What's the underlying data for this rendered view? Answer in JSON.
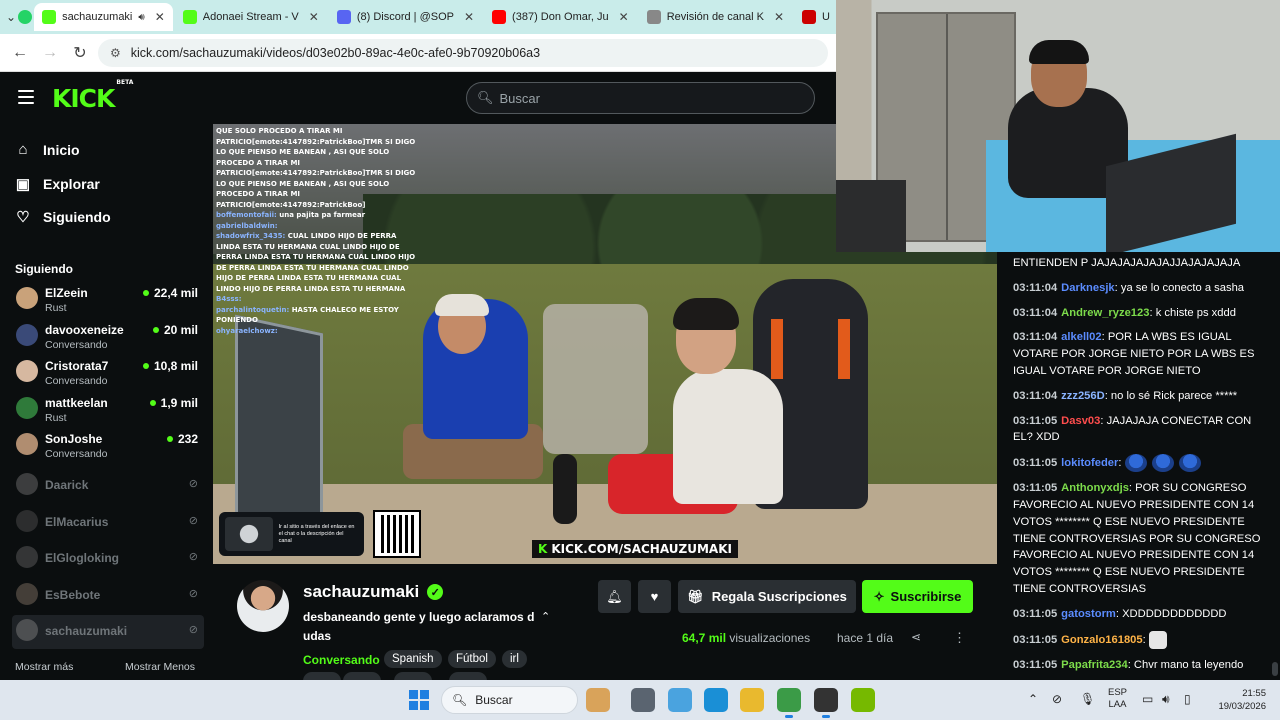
{
  "browser": {
    "tabs": [
      {
        "title": "sachauzumaki",
        "favicon_color": "#53fc18",
        "active": true,
        "audio": true
      },
      {
        "title": "Adonaei Stream - V",
        "favicon_color": "#53fc18",
        "active": false
      },
      {
        "title": "(8) Discord | @SOP",
        "favicon_color": "#5865f2",
        "active": false
      },
      {
        "title": "(387) Don Omar, Ju",
        "favicon_color": "#ff0000",
        "active": false
      },
      {
        "title": "Revisión de canal K",
        "favicon_color": "#888888",
        "active": false
      },
      {
        "title": "U",
        "favicon_color": "#cc0000",
        "active": false
      }
    ],
    "url": "kick.com/sachauzumaki/videos/d03e02b0-89ac-4e0c-afe0-9b70920b06a3"
  },
  "header": {
    "logo": "KICK",
    "logo_badge": "BETA",
    "search_placeholder": "Buscar"
  },
  "sidebar": {
    "nav": [
      {
        "label": "Inicio",
        "icon": "home-icon"
      },
      {
        "label": "Explorar",
        "icon": "compass-icon"
      },
      {
        "label": "Siguiendo",
        "icon": "heart-icon"
      }
    ],
    "following_title": "Siguiendo",
    "live_channels": [
      {
        "name": "ElZeein",
        "category": "Rust",
        "viewers": "22,4 mil",
        "avatar_color": "#c9a27a"
      },
      {
        "name": "davooxeneize",
        "category": "Conversando",
        "viewers": "20 mil",
        "avatar_color": "#3a4a78"
      },
      {
        "name": "Cristorata7",
        "category": "Conversando",
        "viewers": "10,8 mil",
        "avatar_color": "#d6b8a0"
      },
      {
        "name": "mattkeelan",
        "category": "Rust",
        "viewers": "1,9 mil",
        "avatar_color": "#2f7a3a"
      },
      {
        "name": "SonJoshe",
        "category": "Conversando",
        "viewers": "232",
        "avatar_color": "#b08d70"
      }
    ],
    "offline_channels": [
      {
        "name": "Daarick",
        "avatar_color": "#777777"
      },
      {
        "name": "ElMacarius",
        "avatar_color": "#555555"
      },
      {
        "name": "ElGlogloking",
        "avatar_color": "#666666"
      },
      {
        "name": "EsBebote",
        "avatar_color": "#8a7a6a"
      },
      {
        "name": "sachauzumaki",
        "avatar_color": "#888888"
      }
    ],
    "show_more": "Mostrar más",
    "show_less": "Mostrar Menos"
  },
  "video_overlay": {
    "chat_lines": [
      {
        "user": "",
        "text": "QUE SOLO PROCEDO A TIRAR MI PATRICIO[emote:4147892:PatrickBoo]TMR SI DIGO LO QUE PIENSO ME BANEAN , ASI QUE SOLO PROCEDO A TIRAR MI PATRICIO[emote:4147892:PatrickBoo]TMR SI DIGO LO QUE PIENSO ME BANEAN , ASI QUE SOLO PROCEDO A TIRAR MI PATRICIO[emote:4147892:PatrickBoo]"
      },
      {
        "user": "boffemontofaii:",
        "text": "una pajita pa farmear"
      },
      {
        "user": "gabrielbaldwin:",
        "text": ""
      },
      {
        "user": "shadowfrix_3435:",
        "text": "CUAL LINDO HIJO DE PERRA LINDA ESTA TU HERMANA CUAL LINDO HIJO DE PERRA LINDA ESTA TU HERMANA CUAL LINDO HIJO DE PERRA LINDA ESTA TU HERMANA CUAL LINDO HIJO DE PERRA LINDA ESTA TU HERMANA CUAL LINDO HIJO DE PERRA LINDA ESTA TU HERMANA"
      },
      {
        "user": "B4sss:",
        "text": ""
      },
      {
        "user": "parchalintoquetin:",
        "text": "HASTA CHALECO ME ESTOY PONIENDO"
      },
      {
        "user": "ohyaraelchowz:",
        "text": ""
      }
    ],
    "card_text": "Ir al sitio a través del enlace en el chat o la descripción del canal",
    "banner": "KICK.COM/SACHAUZUMAKI"
  },
  "stream_info": {
    "streamer": "sachauzumaki",
    "title": "desbaneando gente y luego aclaramos d udas",
    "category": "Conversando",
    "tags": [
      "Spanish",
      "Fútbol",
      "irl",
      "",
      "",
      "",
      ""
    ],
    "gift_label": "Regala Suscripciones",
    "subscribe_label": "Suscribirse",
    "views_count": "64,7 mil",
    "views_label": "visualizaciones",
    "ago": "hace 1 día"
  },
  "chat": {
    "messages": [
      {
        "time": "",
        "user": "",
        "user_color": "#ffffff",
        "text": "ENTIENDEN P JAJAJAJAJAJAJJAJAJAJAJA"
      },
      {
        "time": "03:11:04",
        "user": "Darknesjk",
        "user_color": "#5b8cff",
        "text": ": ya se lo conecto a sasha"
      },
      {
        "time": "03:11:04",
        "user": "Andrew_ryze123",
        "user_color": "#7ddc4b",
        "text": ": k chiste ps xddd"
      },
      {
        "time": "03:11:04",
        "user": "alkell02",
        "user_color": "#5b8cff",
        "text": ": POR LA WBS ES IGUAL VOTARE POR JORGE NIETO POR LA WBS ES IGUAL VOTARE POR JORGE NIETO"
      },
      {
        "time": "03:11:04",
        "user": "zzz256D",
        "user_color": "#8ab4ff",
        "text": ": no lo sé Rick parece *****"
      },
      {
        "time": "03:11:05",
        "user": "Dasv03",
        "user_color": "#ff4d4d",
        "text": ": JAJAJAJA CONECTAR CON EL? XDD"
      },
      {
        "time": "03:11:05",
        "user": "lokitofeder",
        "user_color": "#5b8cff",
        "text": ":",
        "emotes": 3
      },
      {
        "time": "03:11:05",
        "user": "Anthonyxdjs",
        "user_color": "#7ddc4b",
        "text": ": POR SU CONGRESO FAVORECIO AL NUEVO PRESIDENTE CON 14 VOTOS ******** Q ESE NUEVO PRESIDENTE TIENE CONTROVERSIAS POR SU CONGRESO FAVORECIO AL NUEVO PRESIDENTE CON 14 VOTOS ******** Q ESE NUEVO PRESIDENTE TIENE CONTROVERSIAS"
      },
      {
        "time": "03:11:05",
        "user": "gatostorm",
        "user_color": "#5b8cff",
        "text": ": XDDDDDDDDDDDD"
      },
      {
        "time": "03:11:05",
        "user": "Gonzalo161805",
        "user_color": "#ffb347",
        "text": ":",
        "sticker": true
      },
      {
        "time": "03:11:05",
        "user": "Papafrita234",
        "user_color": "#7ddc4b",
        "text": ": Chvr mano ta leyendo"
      }
    ]
  },
  "taskbar": {
    "search_label": "Buscar",
    "language": "ESP",
    "layout": "LAA",
    "time": "21:55",
    "date": "19/03/2026",
    "apps": [
      {
        "name": "sandwich-app-icon",
        "color": "#d9a35a"
      },
      {
        "name": "terminal-app-icon",
        "color": "#5a6470"
      },
      {
        "name": "notes-app-icon",
        "color": "#4aa3df"
      },
      {
        "name": "edge-app-icon",
        "color": "#1a8fd6"
      },
      {
        "name": "file-explorer-icon",
        "color": "#e9b92e"
      },
      {
        "name": "chrome-app-icon",
        "color": "#3b9b47"
      },
      {
        "name": "obs-app-icon",
        "color": "#333333"
      },
      {
        "name": "nvidia-app-icon",
        "color": "#76b900"
      }
    ]
  },
  "colors": {
    "kick_green": "#53fc18",
    "page_bg": "#0b0e0f",
    "button_dark": "#2a2f33"
  }
}
